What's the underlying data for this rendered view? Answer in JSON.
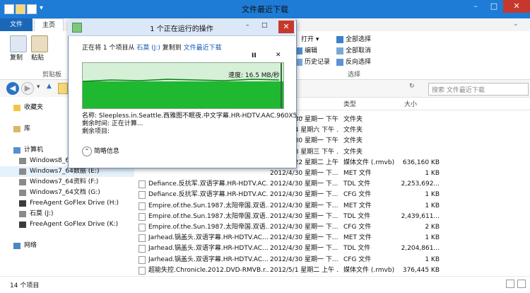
{
  "window": {
    "title": "文件最近下载",
    "controls": {
      "minimize": "–",
      "maximize": "□",
      "close": "✕"
    }
  },
  "ribbon": {
    "tabs": [
      {
        "label": "文件"
      },
      {
        "label": "主页"
      }
    ],
    "clipboard": {
      "copy": "复制",
      "paste": "粘贴",
      "group": "剪贴板"
    },
    "open": {
      "open_label": "打开",
      "edit_label": "编辑",
      "history_label": "历史记录"
    },
    "select": {
      "select_all": "全部选择",
      "select_none": "全部取消",
      "invert": "反向选择",
      "group": "选择"
    }
  },
  "address": {
    "search_placeholder": "搜索 文件最近下载"
  },
  "nav": {
    "favorites": "收藏夹",
    "libraries": "库",
    "computer": "计算机",
    "drives": [
      {
        "label": "Windows8_64"
      },
      {
        "label": "Windows7_64数据 (E:)"
      },
      {
        "label": "Windows7_64资料 (F:)"
      },
      {
        "label": "Windows7_64文档 (G:)"
      },
      {
        "label": "FreeAgent GoFlex Drive (H:)"
      },
      {
        "label": "石莫 (J:)"
      },
      {
        "label": "FreeAgent GoFlex Drive (K:)"
      }
    ],
    "network": "网络"
  },
  "columns": {
    "type": "类型",
    "size": "大小"
  },
  "files": [
    {
      "name": "",
      "date": "2012/4/30 星期一 下午 ...",
      "type": "文件夹",
      "size": ""
    },
    {
      "name": "",
      "date": "2012/5/4 星期六 下午 ...",
      "type": "文件夹",
      "size": ""
    },
    {
      "name": "",
      "date": "2012/4/30 星期一 下午 ...",
      "type": "文件夹",
      "size": ""
    },
    {
      "name": "",
      "date": "2012/5/3 星期三 下午 ...",
      "type": "文件夹",
      "size": ""
    },
    {
      "name": "",
      "date": "2012/4/22 星期二 上午 ...",
      "type": "媒体文件 (.rmvb)",
      "size": "636,160 KB"
    },
    {
      "name": "",
      "date": "2012/4/30 星期一 下...",
      "type": "MET 文件",
      "size": "1 KB"
    },
    {
      "name": "Defiance.反抗军.双语字幕.HR-HDTV.AC...",
      "date": "2012/4/30 星期一 下...",
      "type": "TDL 文件",
      "size": "2,253,692..."
    },
    {
      "name": "Defiance.反抗军.双语字幕.HR-HDTV.AC...",
      "date": "2012/4/30 星期一 下...",
      "type": "CFG 文件",
      "size": "1 KB"
    },
    {
      "name": "Empire.of.the.Sun.1987.太阳帝国.双语...",
      "date": "2012/4/30 星期一 下...",
      "type": "MET 文件",
      "size": "1 KB"
    },
    {
      "name": "Empire.of.the.Sun.1987.太阳帝国.双语...",
      "date": "2012/4/30 星期一 下...",
      "type": "TDL 文件",
      "size": "2,439,611..."
    },
    {
      "name": "Empire.of.the.Sun.1987.太阳帝国.双语...",
      "date": "2012/4/30 星期一 下...",
      "type": "CFG 文件",
      "size": "2 KB"
    },
    {
      "name": "Jarhead.锅盖头.双语字幕.HR-HDTV.AC...",
      "date": "2012/4/30 星期一 下...",
      "type": "MET 文件",
      "size": "1 KB"
    },
    {
      "name": "Jarhead.锅盖头.双语字幕.HR-HDTV.AC...",
      "date": "2012/4/30 星期一 下...",
      "type": "TDL 文件",
      "size": "2,204,861..."
    },
    {
      "name": "Jarhead.锅盖头.双语字幕.HR-HDTV.AC...",
      "date": "2012/4/30 星期一 下...",
      "type": "CFG 文件",
      "size": "1 KB"
    },
    {
      "name": "超能失控.Chronicle.2012.DVD-RMVB.r...",
      "date": "2012/5/1 星期二 上午 ...",
      "type": "媒体文件 (.rmvb)",
      "size": "376,445 KB"
    }
  ],
  "status": {
    "count": "14 个项目"
  },
  "dialog": {
    "title": "1 个正在运行的操作",
    "copy_prefix": "正在将 1 个项目从",
    "source": "石莫 (J:)",
    "copy_middle": "复制到",
    "dest": "文件最近下载",
    "pause": "II",
    "cancel": "✕",
    "speed": "速度: 16.5 MB/秒",
    "progress": 0.98,
    "name_label": "名称:",
    "name_value": "Sleepless.in.Seattle.西雅图不眠夜.中文字幕.HR-HDTV.AAC.960X5...",
    "remaining_time": "剩余时间: 正在计算...",
    "remaining_items": "剩余项目:",
    "details": "简略信息",
    "min_btn": "–",
    "max_btn": "□",
    "close_btn": "✕"
  },
  "colors": {
    "accent": "#1e7bd6",
    "progress_green": "#1fb831",
    "close_red": "#c7382c",
    "link_blue": "#1759b3"
  }
}
